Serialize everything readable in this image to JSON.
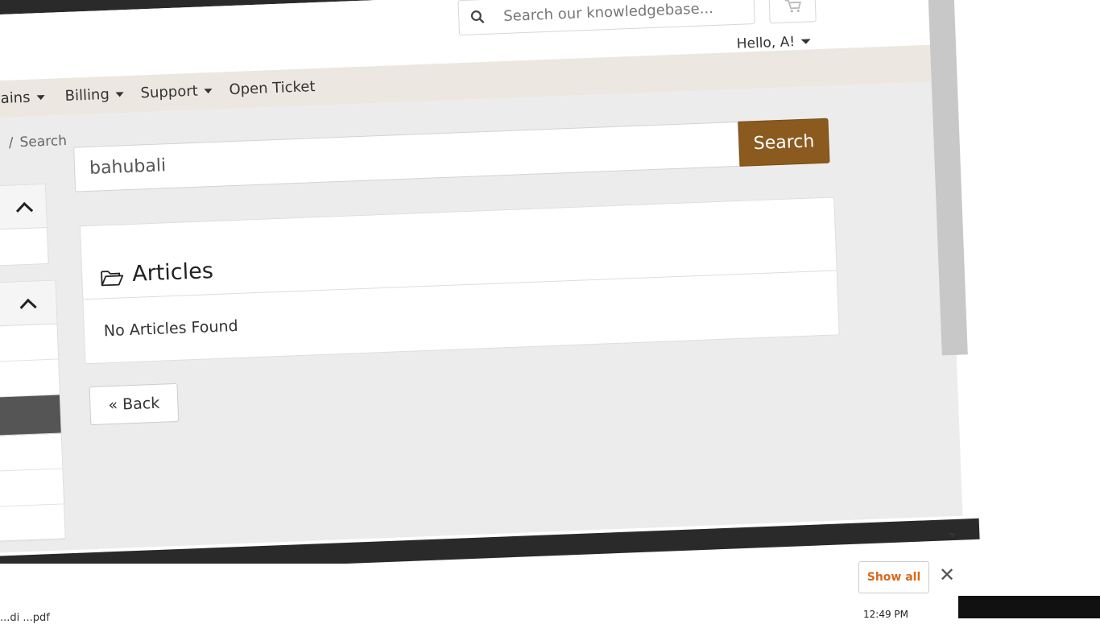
{
  "header": {
    "kb_search_placeholder": "Search our knowledgebase...",
    "cart_count": "0",
    "greeting": "Hello, A!"
  },
  "nav": {
    "items": [
      {
        "label": "ains",
        "has_caret": true
      },
      {
        "label": "Billing",
        "has_caret": true
      },
      {
        "label": "Support",
        "has_caret": true
      },
      {
        "label": "Open Ticket",
        "has_caret": false
      }
    ]
  },
  "breadcrumb": {
    "separator": "/",
    "current": "Search"
  },
  "search": {
    "value": "bahubali",
    "button_label": "Search"
  },
  "articles": {
    "title": "Articles",
    "empty_message": "No Articles Found"
  },
  "back_button": "« Back",
  "downloads": {
    "show_all_label": "Show all",
    "file_label": "...di ...pdf"
  },
  "clock": "12:49 PM",
  "colors": {
    "brand_button": "#8b5a1e",
    "nav_bg": "#ece7e1",
    "content_bg": "#ececec",
    "badge": "#c9a227",
    "show_all_text": "#d86a1a"
  }
}
